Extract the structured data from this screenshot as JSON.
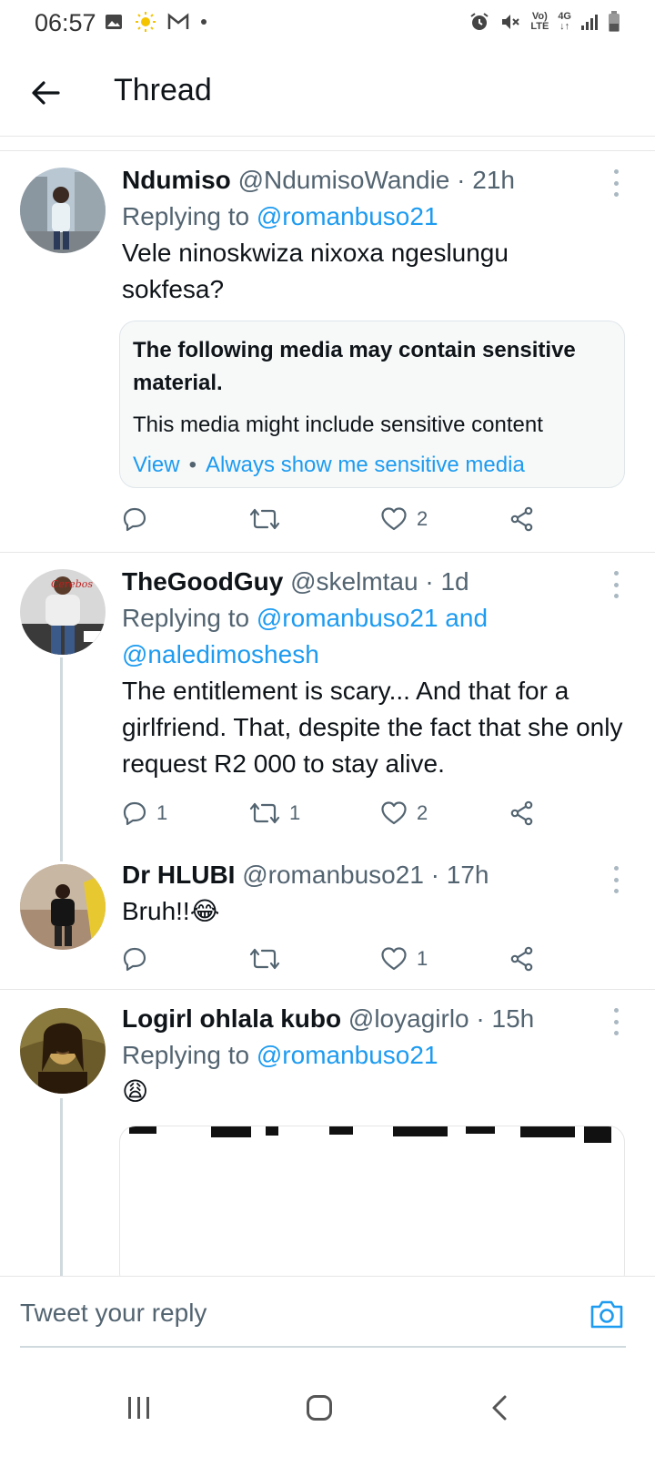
{
  "status_bar": {
    "time": "06:57",
    "volte_top": "Vo)",
    "volte_bottom": "LTE",
    "network": "4G"
  },
  "header": {
    "title": "Thread"
  },
  "tweets": [
    {
      "name": "Ndumiso",
      "handle": "@NdumisoWandie",
      "time": "· 21h",
      "replying_prefix": "Replying to",
      "replying_to": "@romanbuso21",
      "text": "Vele ninoskwiza nixoxa ngeslungu sokfesa?",
      "sensitive": {
        "title": "The following media may contain sensitive material.",
        "description": "This media might include sensitive content",
        "view": "View",
        "separator": "•",
        "always": "Always show me sensitive media"
      },
      "replies": "",
      "retweets": "",
      "likes": "2"
    },
    {
      "name": "TheGoodGuy",
      "handle": "@skelmtau",
      "time": "· 1d",
      "replying_prefix": "Replying to",
      "replying_to": "@romanbuso21 and @naledimoshesh",
      "text": "The entitlement is scary... And that for a girlfriend. That, despite the fact that she only request R2 000 to stay alive.",
      "replies": "1",
      "retweets": "1",
      "likes": "2"
    },
    {
      "name": "Dr HLUBI",
      "handle": "@romanbuso21",
      "time": "· 17h",
      "text": "Bruh!!😂",
      "replies": "",
      "retweets": "",
      "likes": "1"
    },
    {
      "name": "Logirl ohlala kubo",
      "handle": "@loyagirlo",
      "time": "· 15h",
      "replying_prefix": "Replying to",
      "replying_to": "@romanbuso21",
      "text": "😩"
    }
  ],
  "reply_bar": {
    "placeholder": "Tweet your reply"
  },
  "colors": {
    "accent": "#1d9bf0",
    "text": "#0f1419",
    "muted": "#536471",
    "divider": "#e6e6e6"
  },
  "icons": [
    "back-arrow-icon",
    "more-icon",
    "reply-icon",
    "retweet-icon",
    "like-icon",
    "share-icon",
    "camera-icon",
    "recent-apps-icon",
    "home-icon",
    "back-nav-icon"
  ]
}
